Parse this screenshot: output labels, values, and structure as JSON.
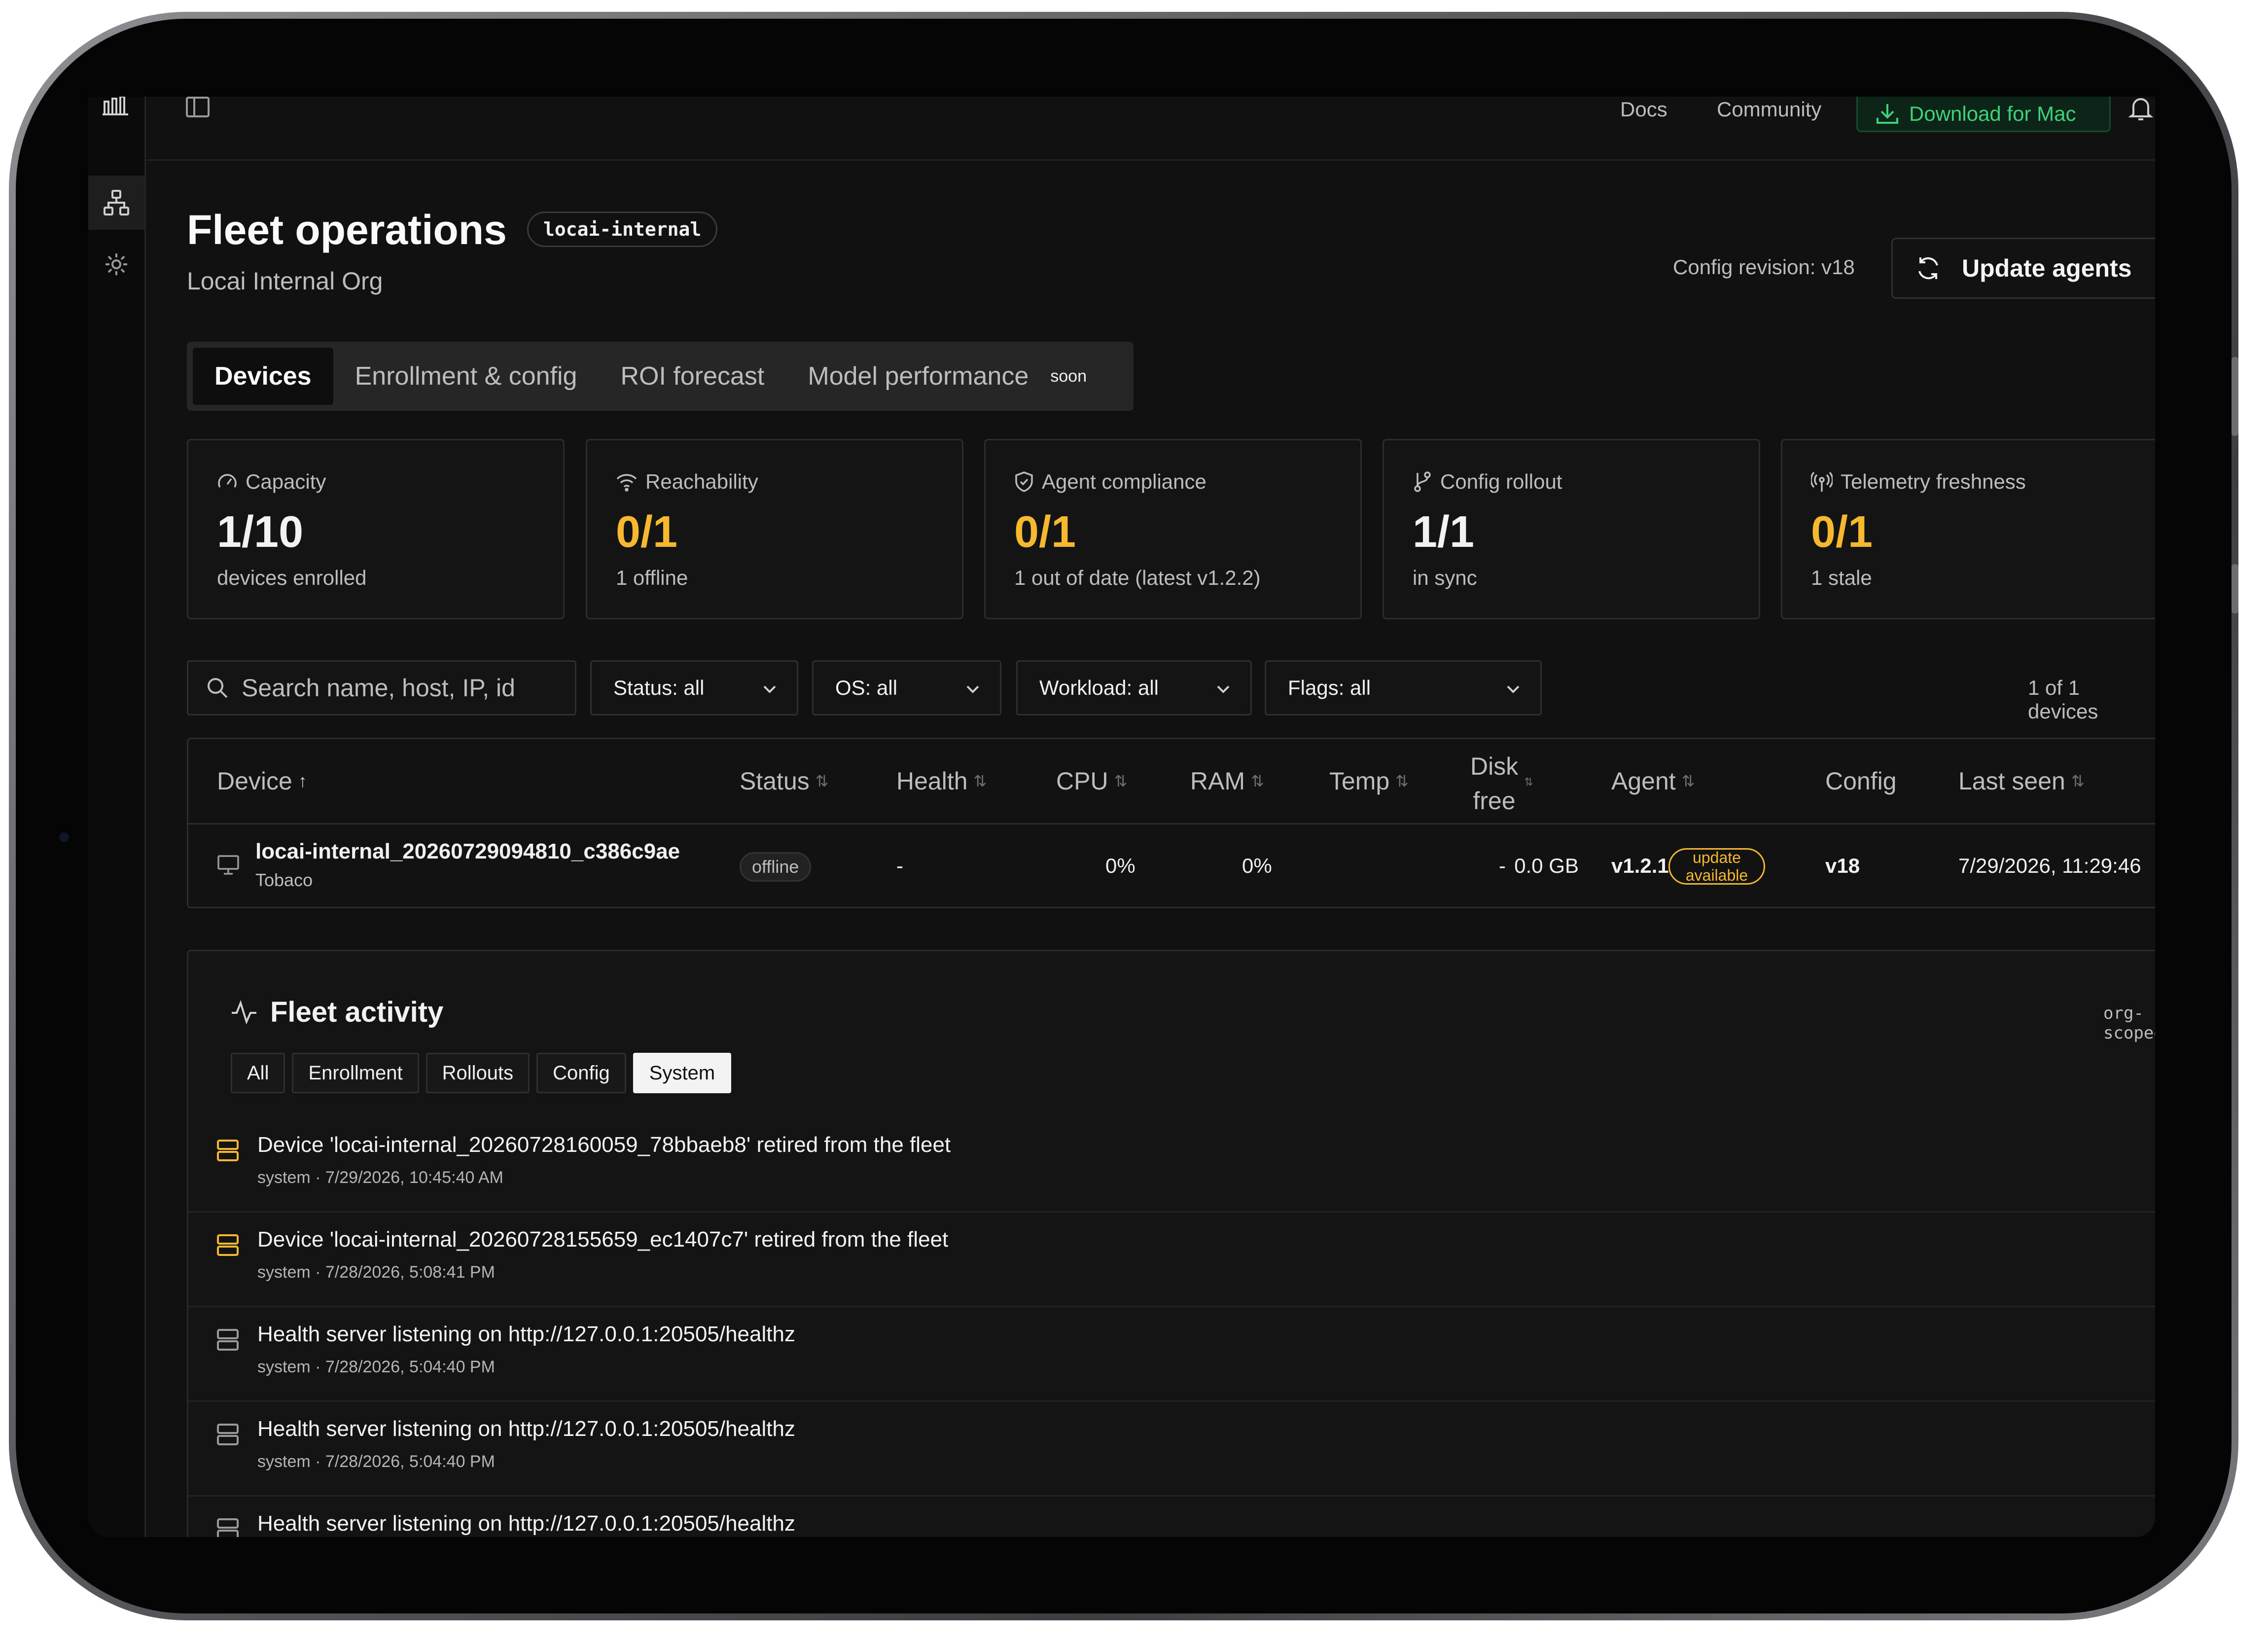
{
  "topbar": {
    "docs": "Docs",
    "community": "Community",
    "download": "Download for Mac"
  },
  "header": {
    "title": "Fleet operations",
    "org_tag": "locai-internal",
    "subtitle": "Locai Internal Org",
    "config_revision": "Config revision: v18",
    "update_agents": "Update agents"
  },
  "tabs": [
    {
      "label": "Devices",
      "active": true
    },
    {
      "label": "Enrollment & config"
    },
    {
      "label": "ROI forecast"
    },
    {
      "label": "Model performance",
      "badge": "soon"
    }
  ],
  "stats": [
    {
      "label": "Capacity",
      "value": "1/10",
      "sub": "devices enrolled",
      "color": "#ffffff"
    },
    {
      "label": "Reachability",
      "value": "0/1",
      "sub": "1 offline",
      "color": "#f5b82e"
    },
    {
      "label": "Agent compliance",
      "value": "0/1",
      "sub": "1 out of date (latest v1.2.2)",
      "color": "#f5b82e"
    },
    {
      "label": "Config rollout",
      "value": "1/1",
      "sub": "in sync",
      "color": "#ffffff"
    },
    {
      "label": "Telemetry freshness",
      "value": "0/1",
      "sub": "1 stale",
      "color": "#f5b82e"
    }
  ],
  "filters": {
    "search_placeholder": "Search name, host, IP, id",
    "status": "Status: all",
    "os": "OS: all",
    "workload": "Workload: all",
    "flags": "Flags: all",
    "count": "1 of 1 devices"
  },
  "table": {
    "headers": {
      "device": "Device",
      "status": "Status",
      "health": "Health",
      "cpu": "CPU",
      "ram": "RAM",
      "temp": "Temp",
      "disk_line1": "Disk",
      "disk_line2": "free",
      "agent": "Agent",
      "config": "Config",
      "last_seen": "Last seen"
    },
    "rows": [
      {
        "name": "locai-internal_20260729094810_c386c9ae",
        "host": "Tobaco",
        "status": "offline",
        "health": "-",
        "cpu": "0%",
        "ram": "0%",
        "temp": "-",
        "disk": "0.0 GB",
        "agent": "v1.2.1",
        "agent_badge_line1": "update",
        "agent_badge_line2": "available",
        "config": "v18",
        "last_seen": "7/29/2026, 11:29:46"
      }
    ]
  },
  "activity": {
    "title": "Fleet activity",
    "scope": "org-scoped",
    "filters": [
      "All",
      "Enrollment",
      "Rollouts",
      "Config",
      "System"
    ],
    "active_filter": "System",
    "events": [
      {
        "text": "Device 'locai-internal_20260728160059_78bbaeb8' retired from the fleet",
        "meta": "system · 7/29/2026, 10:45:40 AM",
        "icon_color": "#f5b82e"
      },
      {
        "text": "Device 'locai-internal_20260728155659_ec1407c7' retired from the fleet",
        "meta": "system · 7/28/2026, 5:08:41 PM",
        "icon_color": "#f5b82e"
      },
      {
        "text": "Health server listening on http://127.0.0.1:20505/healthz",
        "meta": "system · 7/28/2026, 5:04:40 PM",
        "icon_color": "#9a9a9a"
      },
      {
        "text": "Health server listening on http://127.0.0.1:20505/healthz",
        "meta": "system · 7/28/2026, 5:04:40 PM",
        "icon_color": "#9a9a9a"
      },
      {
        "text": "Health server listening on http://127.0.0.1:20505/healthz",
        "meta": "",
        "icon_color": "#9a9a9a"
      }
    ]
  },
  "colors": {
    "accent_warning": "#f5b82e",
    "accent_success": "#3ed37a"
  }
}
